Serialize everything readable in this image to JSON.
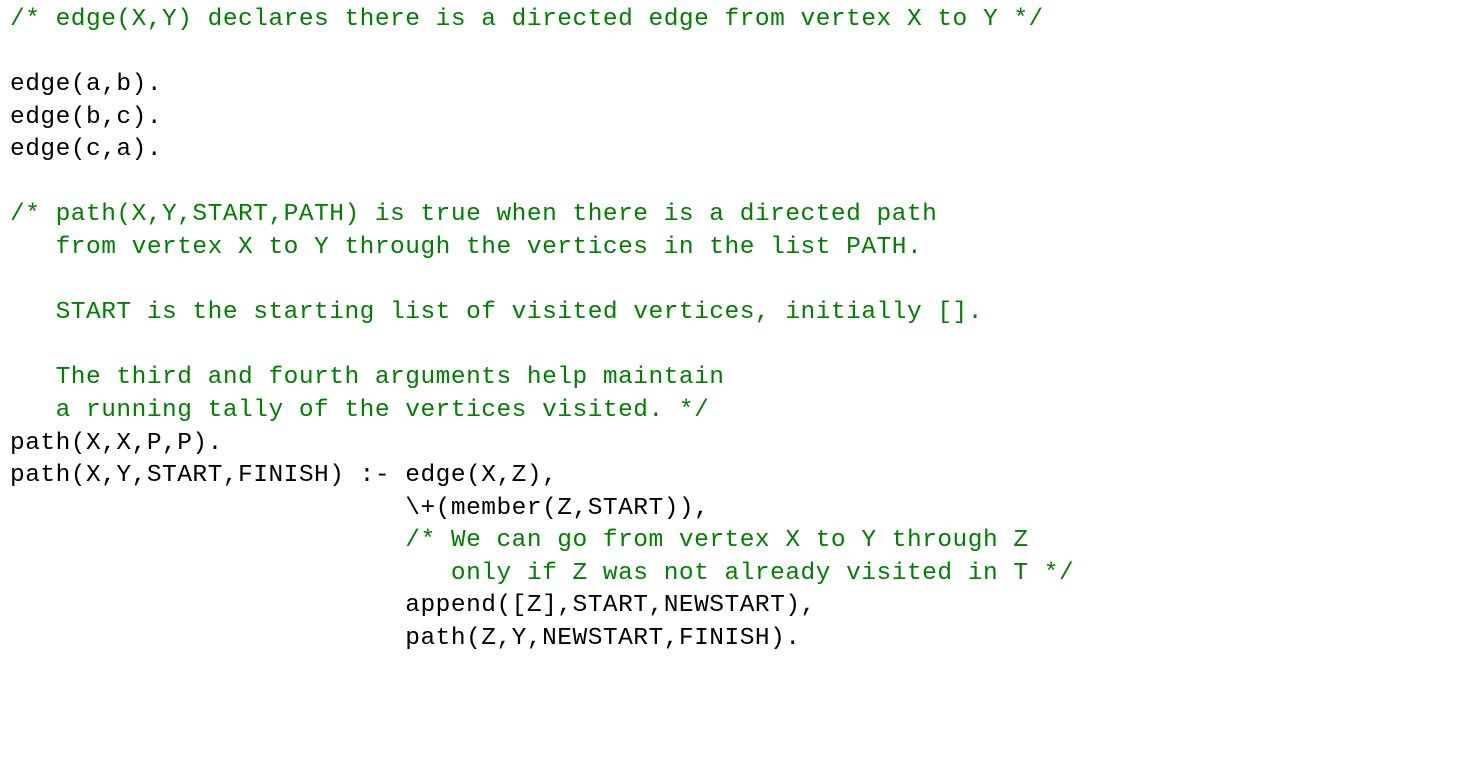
{
  "code": {
    "lines": [
      {
        "segments": [
          {
            "cls": "c",
            "text": "/* edge(X,Y) declares there is a directed edge from vertex X to Y */"
          }
        ]
      },
      {
        "segments": [
          {
            "cls": "k",
            "text": ""
          }
        ]
      },
      {
        "segments": [
          {
            "cls": "k",
            "text": "edge(a,b)."
          }
        ]
      },
      {
        "segments": [
          {
            "cls": "k",
            "text": "edge(b,c)."
          }
        ]
      },
      {
        "segments": [
          {
            "cls": "k",
            "text": "edge(c,a)."
          }
        ]
      },
      {
        "segments": [
          {
            "cls": "k",
            "text": ""
          }
        ]
      },
      {
        "segments": [
          {
            "cls": "c",
            "text": "/* path(X,Y,START,PATH) is true when there is a directed path"
          }
        ]
      },
      {
        "segments": [
          {
            "cls": "c",
            "text": "   from vertex X to Y through the vertices in the list PATH."
          }
        ]
      },
      {
        "segments": [
          {
            "cls": "c",
            "text": ""
          }
        ]
      },
      {
        "segments": [
          {
            "cls": "c",
            "text": "   START is the starting list of visited vertices, initially []."
          }
        ]
      },
      {
        "segments": [
          {
            "cls": "c",
            "text": ""
          }
        ]
      },
      {
        "segments": [
          {
            "cls": "c",
            "text": "   The third and fourth arguments help maintain"
          }
        ]
      },
      {
        "segments": [
          {
            "cls": "c",
            "text": "   a running tally of the vertices visited. */"
          }
        ]
      },
      {
        "segments": [
          {
            "cls": "k",
            "text": "path(X,X,P,P)."
          }
        ]
      },
      {
        "segments": [
          {
            "cls": "k",
            "text": "path(X,Y,START,FINISH) :- edge(X,Z),"
          }
        ]
      },
      {
        "segments": [
          {
            "cls": "k",
            "text": "                          \\+(member(Z,START)),"
          }
        ]
      },
      {
        "segments": [
          {
            "cls": "k",
            "text": "                          "
          },
          {
            "cls": "c",
            "text": "/* We can go from vertex X to Y through Z"
          }
        ]
      },
      {
        "segments": [
          {
            "cls": "k",
            "text": "                          "
          },
          {
            "cls": "c",
            "text": "   only if Z was not already visited in T */"
          }
        ]
      },
      {
        "segments": [
          {
            "cls": "k",
            "text": "                          append([Z],START,NEWSTART),"
          }
        ]
      },
      {
        "segments": [
          {
            "cls": "k",
            "text": "                          path(Z,Y,NEWSTART,FINISH)."
          }
        ]
      }
    ]
  }
}
